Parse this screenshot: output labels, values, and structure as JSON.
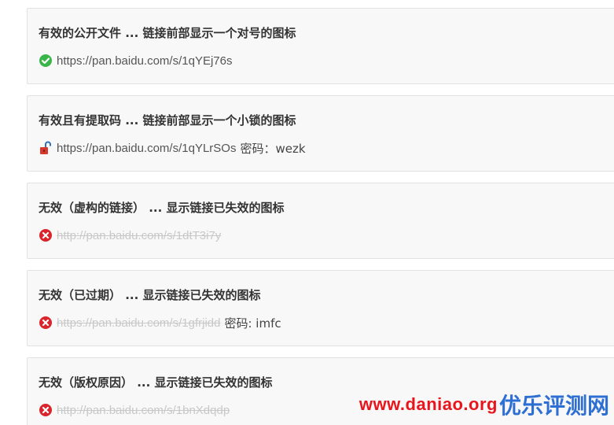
{
  "cards": [
    {
      "title": "有效的公开文件 ... 链接前部显示一个对号的图标",
      "icon": "check-circle-icon",
      "link": "https://pan.baidu.com/s/1qYEj76s",
      "code": ""
    },
    {
      "title": "有效且有提取码 ... 链接前部显示一个小锁的图标",
      "icon": "unlocked-padlock-icon",
      "link": "https://pan.baidu.com/s/1qYLrSOs",
      "code": "密码：wezk"
    },
    {
      "title": "无效（虚构的链接） ... 显示链接已失效的图标",
      "icon": "error-circle-icon",
      "link": "http://pan.baidu.com/s/1dtT3i7y",
      "code": ""
    },
    {
      "title": "无效（已过期） ... 显示链接已失效的图标",
      "icon": "error-circle-icon",
      "link": "https://pan.baidu.com/s/1gfrjidd",
      "code": "密码: imfc"
    },
    {
      "title": "无效（版权原因） ... 显示链接已失效的图标",
      "icon": "error-circle-icon",
      "link": "http://pan.baidu.com/s/1bnXdqdp",
      "code": ""
    }
  ],
  "watermark": {
    "url": "www.daniao.org",
    "name": "优乐评测网"
  },
  "colors": {
    "valid_icon": "#3bb54a",
    "error_icon": "#d9252b",
    "lock_body": "#d63a2f",
    "lock_shackle": "#2e6fb6",
    "watermark_url": "#e8161c",
    "watermark_name": "#2d6fd3"
  }
}
